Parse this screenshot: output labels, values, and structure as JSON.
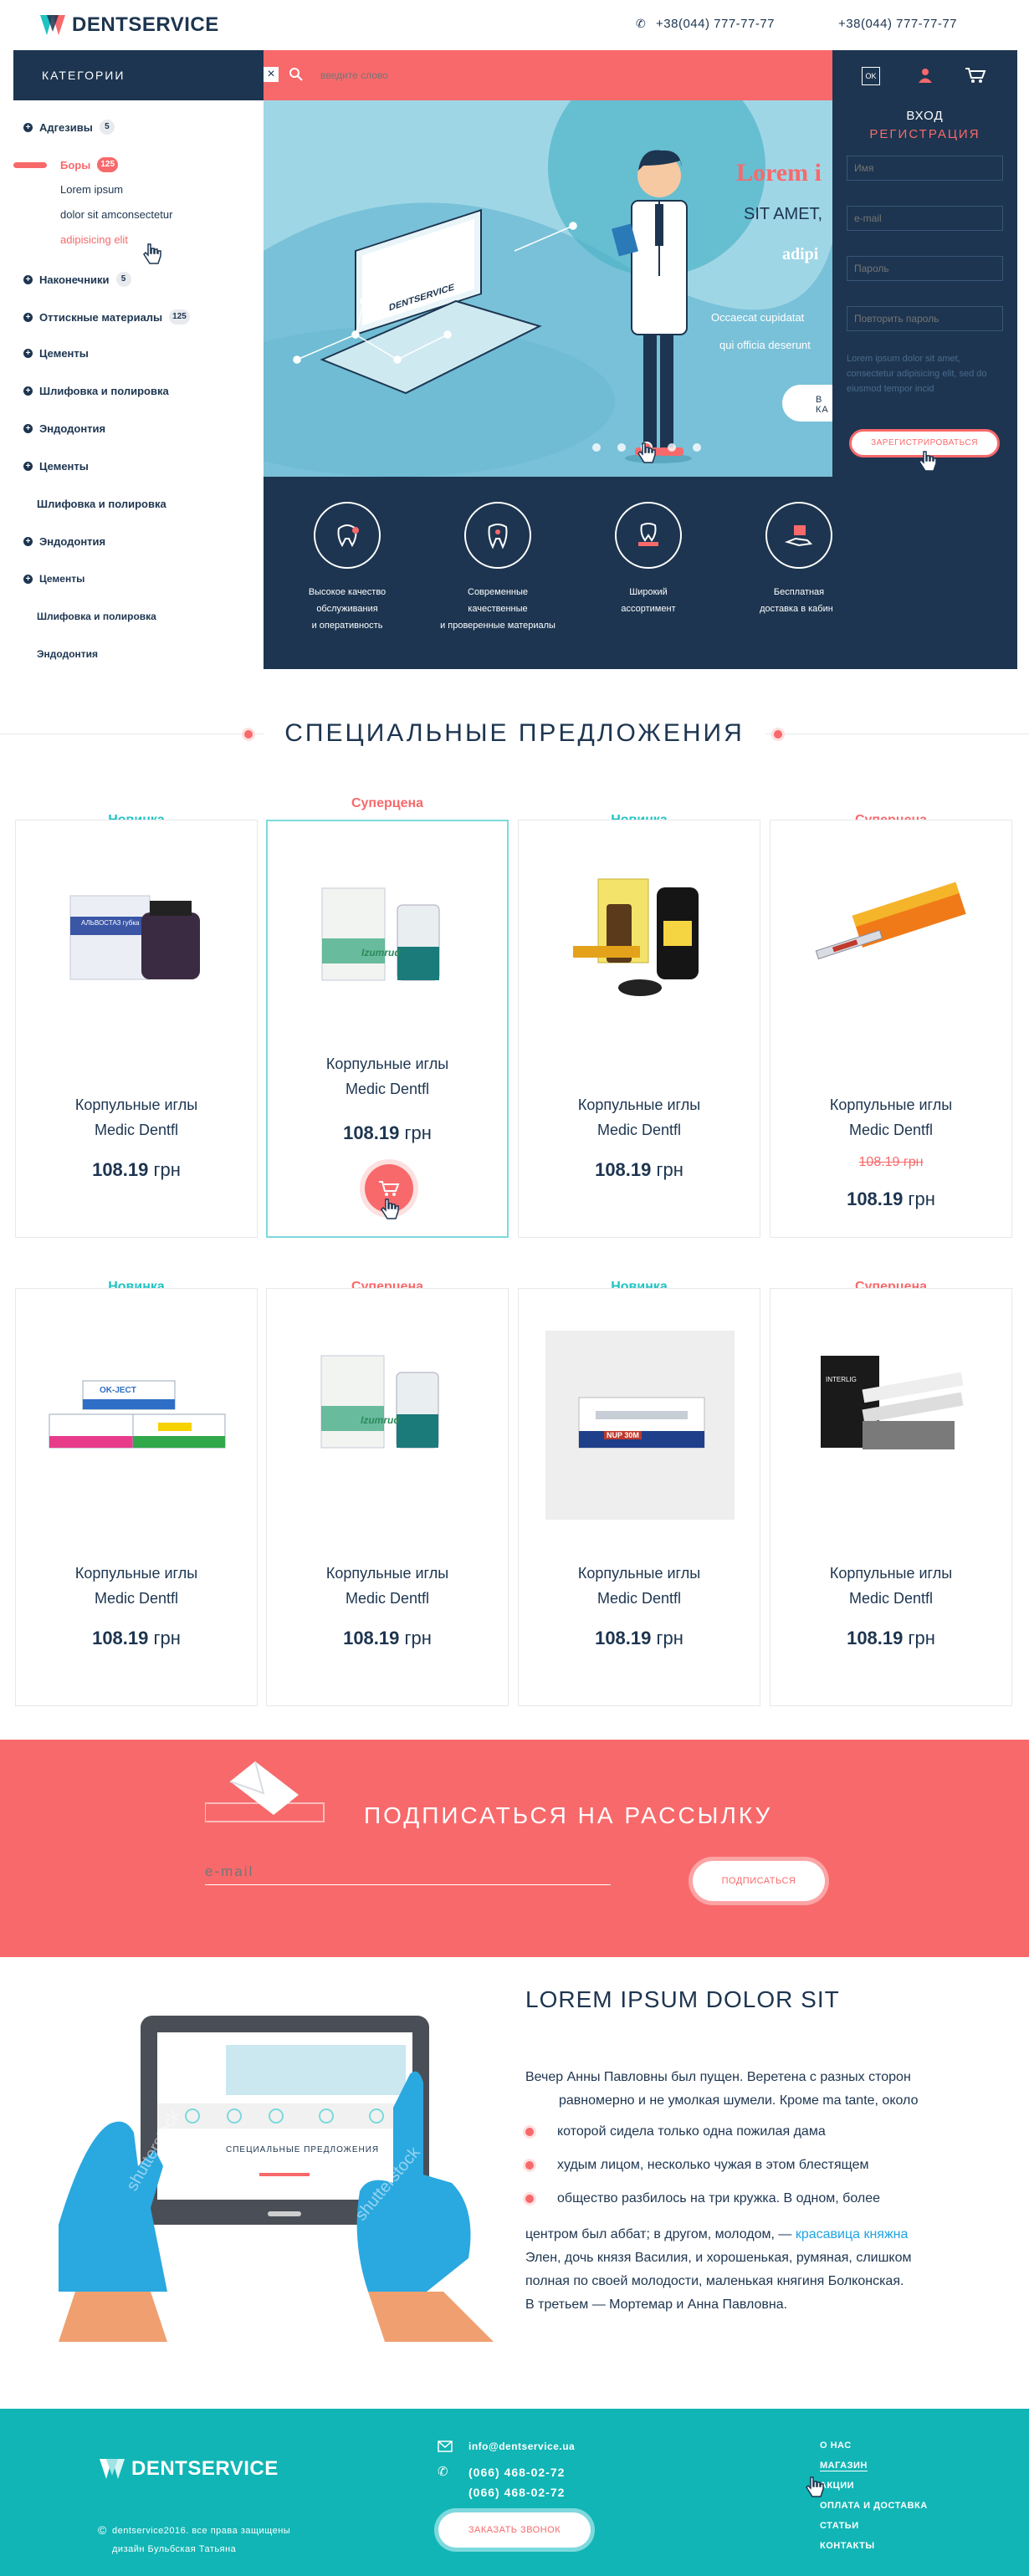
{
  "header": {
    "brand": "DENTSERVICE",
    "phone1": "+38(044) 777-77-77",
    "phone2": "+38(044) 777-77-77"
  },
  "categories": {
    "title": "КАТЕГОРИИ",
    "items": [
      {
        "label": "Адгезивы",
        "count": "5"
      },
      {
        "label": "Боры",
        "count": "125"
      },
      {
        "label": "Наконечники",
        "count": "5"
      },
      {
        "label": "Оттискные материалы",
        "count": "125"
      },
      {
        "label": "Цементы"
      },
      {
        "label": "Шлифовка и полировка"
      },
      {
        "label": "Эндодонтия"
      },
      {
        "label": "Цементы"
      },
      {
        "label": "Шлифовка и полировка"
      },
      {
        "label": "Эндодонтия"
      },
      {
        "label": "Цементы"
      },
      {
        "label": "Шлифовка и полировка"
      },
      {
        "label": "Эндодонтия"
      }
    ],
    "subitems": [
      "Lorem ipsum",
      "dolor sit amconsectetur",
      "adipisicing elit"
    ]
  },
  "search": {
    "placeholder": "введите слово"
  },
  "hero": {
    "heading": "Lorem i",
    "line1": "SIT AMET,",
    "line2": "adipi",
    "text1": "Occaecat cupidatat",
    "text2": "qui officia deserunt",
    "button": "В КА",
    "laptop_brand": "DENTSERVICE"
  },
  "features": [
    {
      "icon": "tooth-drill-icon",
      "lines": [
        "Высокое качество",
        "обслуживания",
        "и оперативность"
      ]
    },
    {
      "icon": "tooth-icon",
      "lines": [
        "Современные",
        "качественные",
        "и проверенные материалы"
      ]
    },
    {
      "icon": "dental-tools-icon",
      "lines": [
        "Широкий",
        "ассортимент"
      ]
    },
    {
      "icon": "delivery-hand-icon",
      "lines": [
        "Бесплатная",
        "доставка в кабине"
      ]
    }
  ],
  "login": {
    "ok": "OK",
    "title": "ВХОД",
    "register": "РЕГИСТРАЦИЯ",
    "name_ph": "Имя",
    "email_ph": "e-mail",
    "pass_ph": "Пароль",
    "pass2_ph": "Повторить пароль",
    "note": "Lorem ipsum dolor sit amet, consectetur adipisicing elit, sed do eiusmod tempor incid",
    "submit": "ЗАРЕГИСТРИРОВАТЬСЯ"
  },
  "special": {
    "title": "СПЕЦИАЛЬНЫЕ ПРЕДЛОЖЕНИЯ"
  },
  "products": [
    {
      "badge": "Новинка",
      "badge_color": "#1fc3c3",
      "name1": "Корпульные иглы",
      "name2": "Medic Dentfl",
      "price": "108.19",
      "currency": "грн"
    },
    {
      "badge": "Суперцена",
      "badge_color": "#f8696b",
      "name1": "Корпульные иглы",
      "name2": "Medic Dentfl",
      "price": "108.19",
      "currency": "грн"
    },
    {
      "badge": "Новинка",
      "badge_color": "#1fc3c3",
      "name1": "Корпульные иглы",
      "name2": "Medic Dentfl",
      "price": "108.19",
      "currency": "грн"
    },
    {
      "badge": "Суперцена",
      "badge_color": "#f8696b",
      "name1": "Корпульные иглы",
      "name2": "Medic Dentfl",
      "old_price": "108.19 грн",
      "price": "108.19",
      "currency": "грн"
    },
    {
      "badge": "Новинка",
      "badge_color": "#1fc3c3",
      "name1": "Корпульные иглы",
      "name2": "Medic Dentfl",
      "price": "108.19",
      "currency": "грн"
    },
    {
      "badge": "Суперцена",
      "badge_color": "#f8696b",
      "name1": "Корпульные иглы",
      "name2": "Medic Dentfl",
      "price": "108.19",
      "currency": "грн"
    },
    {
      "badge": "Новинка",
      "badge_color": "#1fc3c3",
      "name1": "Корпульные иглы",
      "name2": "Medic Dentfl",
      "price": "108.19",
      "currency": "грн"
    },
    {
      "badge": "Суперцена",
      "badge_color": "#f8696b",
      "name1": "Корпульные иглы",
      "name2": "Medic Dentfl",
      "price": "108.19",
      "currency": "грн"
    }
  ],
  "product_labels": {
    "p1": "АЛЬВОСТАЗ губка",
    "p2": "Izumrud",
    "p4": "OK-JECT",
    "p6": "Izumrud",
    "p7": "NUP 30M",
    "p8": "INTERLIG"
  },
  "newsletter": {
    "title": "ПОДПИСАТЬСЯ НА РАССЫЛКУ",
    "email_ph": "e-mail",
    "button": "ПОДПИСАТЬСЯ"
  },
  "about": {
    "title": "LOREM IPSUM DOLOR SIT",
    "p1a": "Вечер Анны Павловны был пущен. Веретена с разных сторон",
    "p1b": "равномерно и не умолкая шумели. Кроме ma tante, около",
    "bullets": [
      "которой сидела только одна пожилая дама",
      "худым лицом, несколько чужая в этом блестящем",
      "общество разбилось на три кружка. В одном, более"
    ],
    "p2a": "центром был аббат; в другом, молодом, —",
    "p2link": "красавица княжна",
    "p2b": "Элен, дочь князя Василия, и хорошенькая, румяная, слишком",
    "p2c": "полная по своей молодости, маленькая княгиня Болконская.",
    "p2d": "В третьем — Мортемар и Анна Павловна.",
    "tablet_title": "СПЕЦИАЛЬНЫЕ ПРЕДЛОЖЕНИЯ",
    "watermark": "shutterstock"
  },
  "footer": {
    "brand": "DENTSERVICE",
    "copyright": "dentservice2016. все права защищены",
    "designer": "дизайн Бульбская Татьяна",
    "email": "info@dentservice.ua",
    "phone1": "(066) 468-02-72",
    "phone2": "(066) 468-02-72",
    "callback": "ЗАКАЗАТЬ ЗВОНОК",
    "links": [
      "О НАС",
      "МАГАЗИН",
      "АКЦИИ",
      "ОПЛАТА И ДОСТАВКА",
      "СТАТЬИ",
      "КОНТАКТЫ"
    ]
  },
  "colors": {
    "navy": "#1d3550",
    "coral": "#f8696b",
    "teal": "#11b5b5",
    "sky": "#9fd6e6"
  }
}
